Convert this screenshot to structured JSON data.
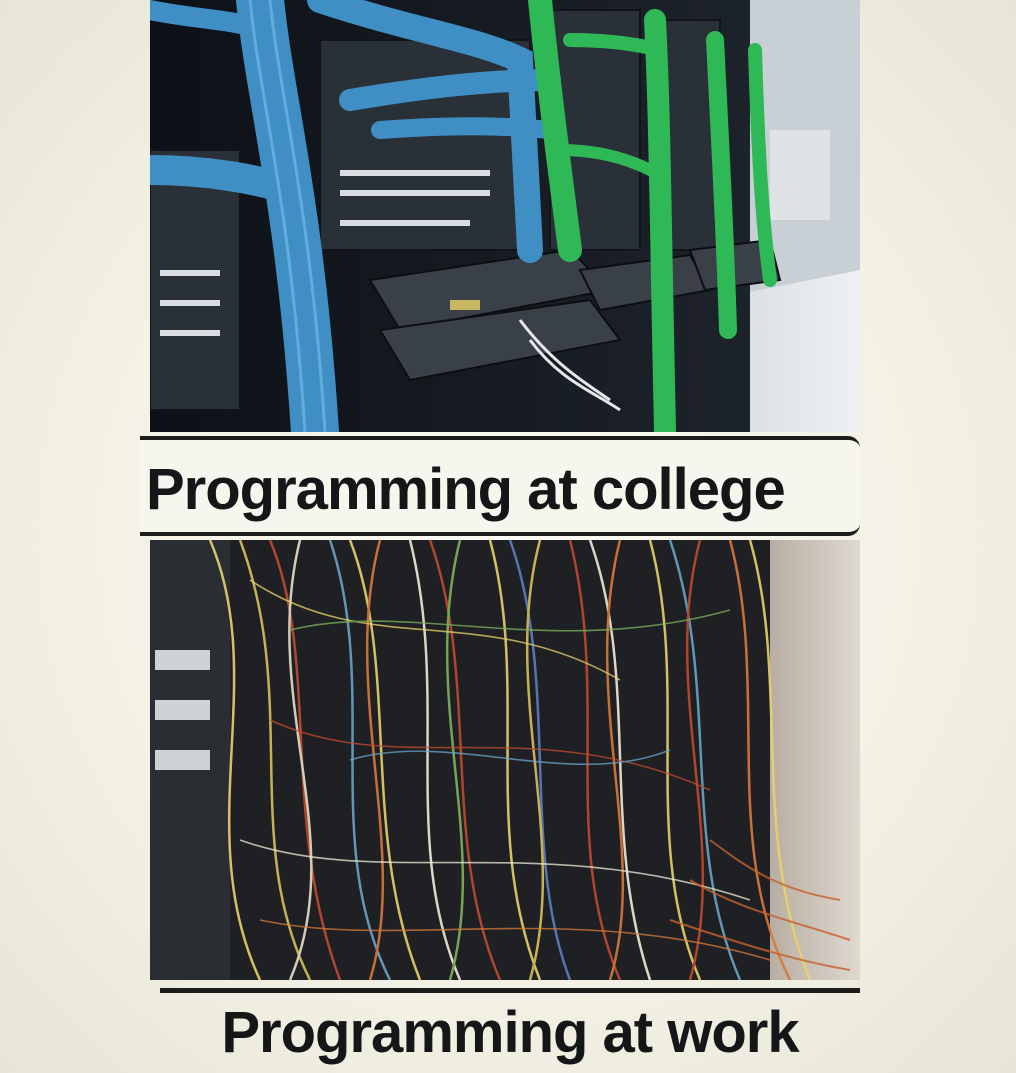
{
  "meme": {
    "top_caption": "Programming at college",
    "bottom_caption": "Programming at work"
  },
  "colors": {
    "background": "#f3f1e4",
    "caption_text": "#141618",
    "neat_cable_blue": "#3f8fc4",
    "neat_cable_green": "#2fb856"
  }
}
